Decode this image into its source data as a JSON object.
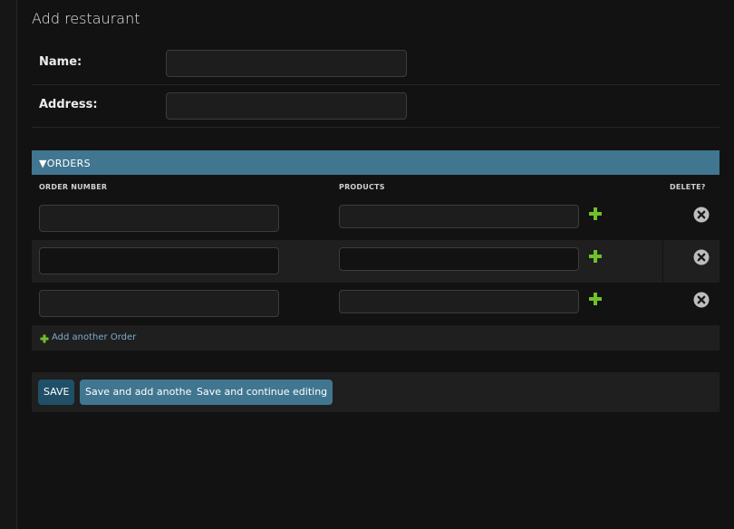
{
  "page": {
    "title": "Add restaurant"
  },
  "form": {
    "name_label": "Name:",
    "name_value": "",
    "address_label": "Address:",
    "address_value": ""
  },
  "inline": {
    "header": "▼ORDERS",
    "columns": {
      "order_number": "ORDER NUMBER",
      "products": "PRODUCTS",
      "delete": "DELETE?"
    },
    "rows": [
      {
        "order_number": "",
        "products": ""
      },
      {
        "order_number": "",
        "products": ""
      },
      {
        "order_number": "",
        "products": ""
      }
    ],
    "add_another": "Add another Order"
  },
  "buttons": {
    "save": "SAVE",
    "save_add_another": "Save and add another",
    "save_continue": "Save and continue editing"
  },
  "icons": {
    "add": "plus-icon",
    "delete": "delete-x-icon"
  },
  "colors": {
    "accent": "#417690",
    "primary_button": "#205067",
    "add_green": "#70bf2b",
    "link": "#79aec8"
  }
}
